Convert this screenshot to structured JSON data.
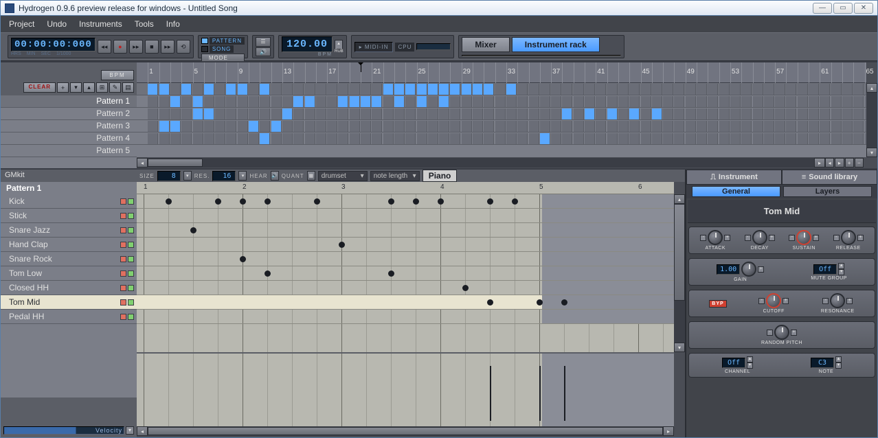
{
  "window": {
    "title": "Hydrogen 0.9.6 preview release for windows - Untitled Song"
  },
  "menu": [
    "Project",
    "Undo",
    "Instruments",
    "Tools",
    "Info"
  ],
  "transport": {
    "time": "00:00:00:000",
    "time_labels": [
      "HRS",
      "MIN",
      "SEC",
      "1/1000"
    ],
    "mode_pattern": "PATTERN",
    "mode_song": "SONG",
    "mode_btn": "MODE",
    "bpm": "120.00",
    "bpm_label": "BPM",
    "rub_label": "RUB",
    "midi": "MIDI-IN",
    "cpu": "CPU",
    "mixer": "Mixer",
    "instrument_rack": "Instrument rack"
  },
  "song": {
    "bpm_toggle": "BPM",
    "clear": "CLEAR",
    "patterns": [
      "Pattern 1",
      "Pattern 2",
      "Pattern 3",
      "Pattern 4",
      "Pattern 5"
    ],
    "active_pattern_index": 0,
    "ruler_cols": 65,
    "playhead_col": 20,
    "cells": {
      "0": [
        1,
        2,
        4,
        6,
        8,
        9,
        11,
        22,
        23,
        24,
        25,
        26,
        27,
        28,
        29,
        30,
        31,
        33
      ],
      "1": [
        3,
        5,
        14,
        15,
        18,
        19,
        20,
        21,
        23,
        25,
        27
      ],
      "2": [
        5,
        6,
        13,
        38,
        40,
        42,
        44,
        46
      ],
      "3": [
        2,
        3,
        10,
        12
      ],
      "4": [
        11,
        36
      ]
    }
  },
  "pattern": {
    "kit": "GMkit",
    "name": "Pattern 1",
    "toolbar": {
      "size_label": "SIZE",
      "size_val": "8",
      "res_label": "RES.",
      "res_val": "16",
      "hear_label": "HEAR",
      "quant_label": "QUANT",
      "combo1": "drumset",
      "combo2": "note length",
      "piano": "Piano"
    },
    "instruments": [
      {
        "name": "Kick",
        "notes": [
          2,
          6,
          8,
          10,
          14,
          20,
          22,
          24,
          28,
          30
        ]
      },
      {
        "name": "Stick",
        "notes": []
      },
      {
        "name": "Snare Jazz",
        "notes": [
          4
        ]
      },
      {
        "name": "Hand Clap",
        "notes": [
          16
        ]
      },
      {
        "name": "Snare Rock",
        "notes": [
          8
        ]
      },
      {
        "name": "Tom Low",
        "notes": [
          10,
          20
        ]
      },
      {
        "name": "Closed HH",
        "notes": [
          26
        ]
      },
      {
        "name": "Tom Mid",
        "notes": [
          28,
          32,
          34
        ],
        "selected": true
      },
      {
        "name": "Pedal HH",
        "notes": []
      }
    ],
    "ruler_beats": 6,
    "velocity_label": "Velocity",
    "velocity_notes": [
      28,
      32,
      34
    ]
  },
  "inspector": {
    "tabs": [
      "Instrument",
      "Sound library"
    ],
    "subtabs": [
      "General",
      "Layers"
    ],
    "instrument_name": "Tom Mid",
    "adsr": [
      "ATTACK",
      "DECAY",
      "SUSTAIN",
      "RELEASE"
    ],
    "gain": {
      "val": "1.00",
      "label": "GAIN"
    },
    "mute_group": {
      "val": "Off",
      "label": "MUTE GROUP"
    },
    "filter": {
      "byp": "BYP",
      "cutoff": "CUTOFF",
      "resonance": "RESONANCE"
    },
    "random_pitch": "RANDOM PITCH",
    "channel": {
      "val": "Off",
      "label": "CHANNEL"
    },
    "note": {
      "val": "C3",
      "label": "NOTE"
    }
  }
}
